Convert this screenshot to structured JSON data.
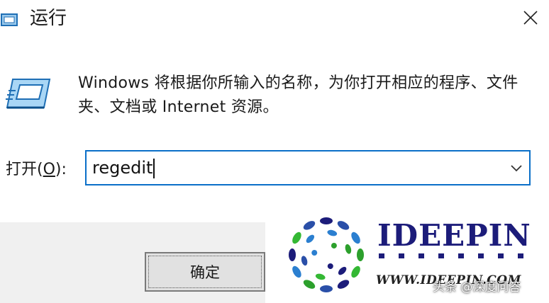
{
  "window": {
    "title": "运行",
    "close_glyph": "✕"
  },
  "description": "Windows 将根据你所输入的名称，为你打开相应的程序、文件夹、文档或 Internet 资源。",
  "open_field": {
    "label_prefix": "打开(",
    "label_accel": "O",
    "label_suffix": "):",
    "value": "regedit"
  },
  "buttons": {
    "ok_label": "确定"
  },
  "watermark": {
    "brand": "IDEEPIN",
    "url": "WWW.IDEEPIN.COM",
    "overlay": "头条 @深度问答"
  },
  "colors": {
    "accent_border": "#0a6fc8",
    "footer_bg": "#f0f0f0",
    "brand": "#1c1c7a"
  },
  "icons": {
    "app": "run-app-icon",
    "close": "close-icon",
    "run": "run-program-icon",
    "dropdown": "chevron-down-icon",
    "watermark": "watermark-logo-icon"
  }
}
